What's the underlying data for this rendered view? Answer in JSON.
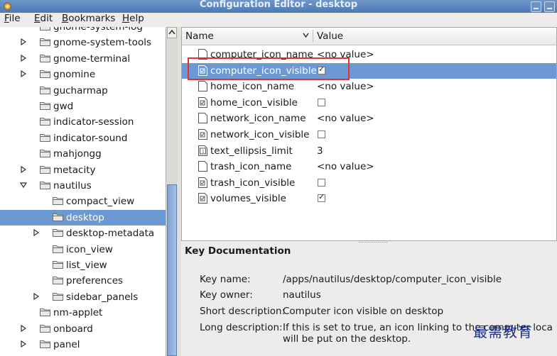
{
  "window": {
    "title": "Configuration Editor - desktop"
  },
  "menu": [
    "File",
    "Edit",
    "Bookmarks",
    "Help"
  ],
  "tree": [
    {
      "label": "gnome-system-log",
      "expander": false,
      "indent": 0
    },
    {
      "label": "gnome-system-tools",
      "expander": "collapsed",
      "indent": 0
    },
    {
      "label": "gnome-terminal",
      "expander": "collapsed",
      "indent": 0
    },
    {
      "label": "gnomine",
      "expander": "collapsed",
      "indent": 0
    },
    {
      "label": "gucharmap",
      "expander": false,
      "indent": 0
    },
    {
      "label": "gwd",
      "expander": false,
      "indent": 0
    },
    {
      "label": "indicator-session",
      "expander": false,
      "indent": 0
    },
    {
      "label": "indicator-sound",
      "expander": false,
      "indent": 0
    },
    {
      "label": "mahjongg",
      "expander": false,
      "indent": 0
    },
    {
      "label": "metacity",
      "expander": "collapsed",
      "indent": 0
    },
    {
      "label": "nautilus",
      "expander": "expanded",
      "indent": 0
    },
    {
      "label": "compact_view",
      "expander": false,
      "indent": 1
    },
    {
      "label": "desktop",
      "expander": false,
      "indent": 1,
      "selected": true
    },
    {
      "label": "desktop-metadata",
      "expander": "collapsed",
      "indent": 1
    },
    {
      "label": "icon_view",
      "expander": false,
      "indent": 1
    },
    {
      "label": "list_view",
      "expander": false,
      "indent": 1
    },
    {
      "label": "preferences",
      "expander": false,
      "indent": 1
    },
    {
      "label": "sidebar_panels",
      "expander": "collapsed",
      "indent": 1
    },
    {
      "label": "nm-applet",
      "expander": false,
      "indent": 0
    },
    {
      "label": "onboard",
      "expander": "collapsed",
      "indent": 0
    },
    {
      "label": "panel",
      "expander": "collapsed",
      "indent": 0
    }
  ],
  "table": {
    "headers": {
      "name": "Name",
      "value": "Value"
    },
    "rows": [
      {
        "name": "computer_icon_name",
        "type": "string",
        "value": "<no value>"
      },
      {
        "name": "computer_icon_visible",
        "type": "bool",
        "checked": true,
        "selected": true
      },
      {
        "name": "home_icon_name",
        "type": "string",
        "value": "<no value>"
      },
      {
        "name": "home_icon_visible",
        "type": "bool",
        "checked": false
      },
      {
        "name": "network_icon_name",
        "type": "string",
        "value": "<no value>"
      },
      {
        "name": "network_icon_visible",
        "type": "bool",
        "checked": false
      },
      {
        "name": "text_ellipsis_limit",
        "type": "int",
        "value": "3"
      },
      {
        "name": "trash_icon_name",
        "type": "string",
        "value": "<no value>"
      },
      {
        "name": "trash_icon_visible",
        "type": "bool",
        "checked": false
      },
      {
        "name": "volumes_visible",
        "type": "bool",
        "checked": true
      }
    ]
  },
  "doc": {
    "title": "Key Documentation",
    "key_name_label": "Key name:",
    "key_name": "/apps/nautilus/desktop/computer_icon_visible",
    "key_owner_label": "Key owner:",
    "key_owner": "nautilus",
    "short_label": "Short description:",
    "short": "Computer icon visible on desktop",
    "long_label": "Long description:",
    "long1": "If this is set to true, an icon linking to the computer location",
    "long2": "will be put on the desktop."
  },
  "watermark": "最需教育"
}
